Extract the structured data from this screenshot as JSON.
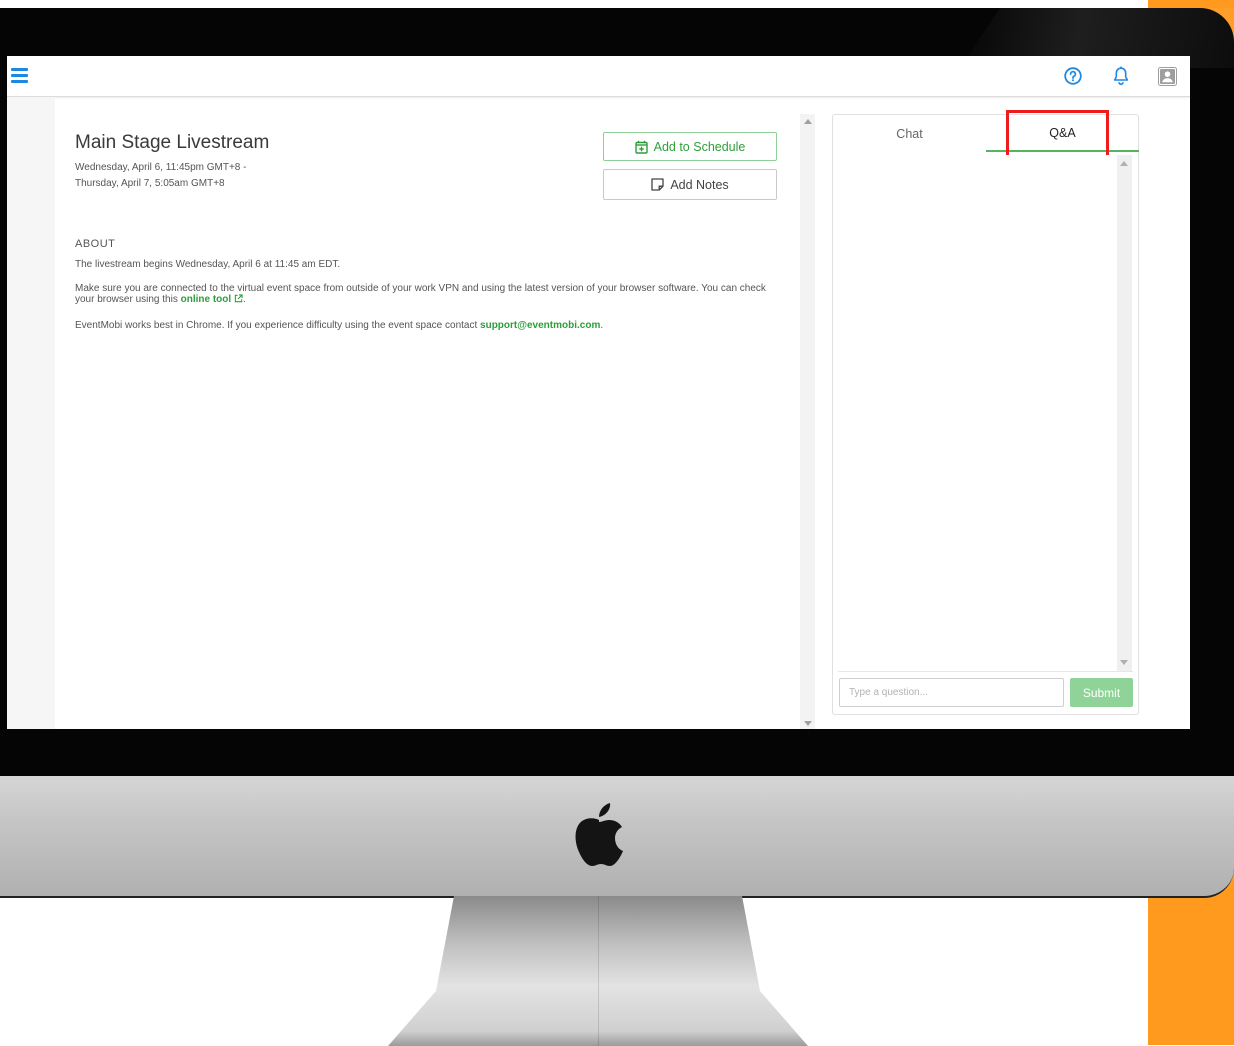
{
  "icons": {
    "menu": "hamburger-icon",
    "help": "question-circle-icon",
    "notifications": "bell-icon",
    "profile": "user-avatar-icon",
    "calendar": "calendar-plus-icon",
    "notes": "sticky-note-icon",
    "external": "external-link-icon",
    "brand": "apple-logo-icon"
  },
  "colors": {
    "accent": "#1e88e5",
    "green": "#2e9e3a",
    "submit": "#8fd398",
    "highlight": "#ee1c1c",
    "backdrop": "#ff9a1f"
  },
  "session": {
    "title": "Main Stage Livestream",
    "date_line_1": "Wednesday, April 6, 11:45pm GMT+8 -",
    "date_line_2": "Thursday, April 7, 5:05am GMT+8",
    "add_to_schedule": "Add to Schedule",
    "add_notes": "Add Notes"
  },
  "about": {
    "heading": "ABOUT",
    "p1": "The livestream begins Wednesday, April 6 at 11:45 am EDT.",
    "p2_text": "Make sure you are connected to the virtual event space from outside of your work VPN and using the latest version of your browser software. You can check your browser using this ",
    "p2_link": "online tool",
    "p2_end": ".",
    "p3_text": "EventMobi works best in Chrome. If you experience difficulty using the event space contact ",
    "p3_link": "support@eventmobi.com",
    "p3_end": "."
  },
  "side_panel": {
    "tabs": [
      {
        "label": "Chat",
        "active": false
      },
      {
        "label": "Q&A",
        "active": true
      }
    ],
    "input_placeholder": "Type a question...",
    "submit_label": "Submit"
  }
}
